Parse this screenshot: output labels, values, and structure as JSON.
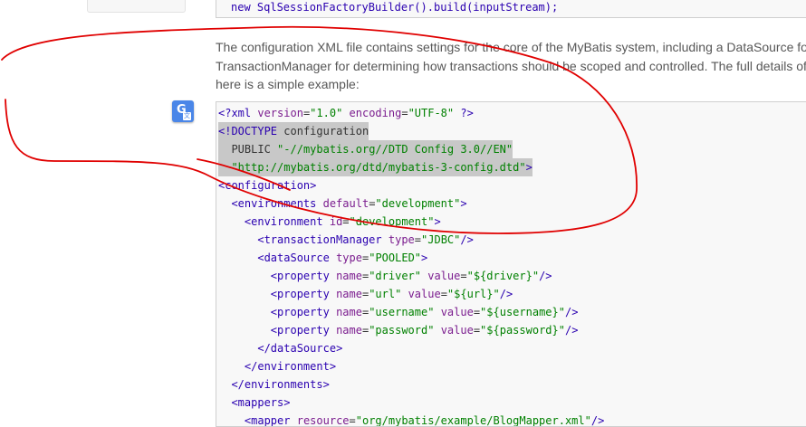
{
  "code_top": {
    "line": "new SqlSessionFactoryBuilder().build(inputStream);"
  },
  "paragraph": {
    "lines": [
      "The configuration XML file contains settings for the core of the MyBatis system, including a DataSource fo",
      "TransactionManager for determining how transactions should be scoped and controlled. The full details of",
      "here is a simple example:"
    ]
  },
  "translate_button": {
    "glyph": "G",
    "sub": "文",
    "color": "#4a86e8"
  },
  "code": {
    "lines": [
      "<?xml version=\"1.0\" encoding=\"UTF-8\" ?>",
      "<!DOCTYPE configuration",
      "  PUBLIC \"-//mybatis.org//DTD Config 3.0//EN\"",
      "  \"http://mybatis.org/dtd/mybatis-3-config.dtd\">",
      "<configuration>",
      "  <environments default=\"development\">",
      "    <environment id=\"development\">",
      "      <transactionManager type=\"JDBC\"/>",
      "      <dataSource type=\"POOLED\">",
      "        <property name=\"driver\" value=\"${driver}\"/>",
      "        <property name=\"url\" value=\"${url}\"/>",
      "        <property name=\"username\" value=\"${username}\"/>",
      "        <property name=\"password\" value=\"${password}\"/>",
      "      </dataSource>",
      "    </environment>",
      "  </environments>",
      "  <mappers>",
      "    <mapper resource=\"org/mybatis/example/BlogMapper.xml\"/>"
    ],
    "highlighted_lines": [
      1,
      2,
      3
    ]
  },
  "colors": {
    "tag": "#2a00b0",
    "attr": "#7b1d8f",
    "value": "#008000",
    "annotation": "#e00000",
    "text": "#575757"
  }
}
